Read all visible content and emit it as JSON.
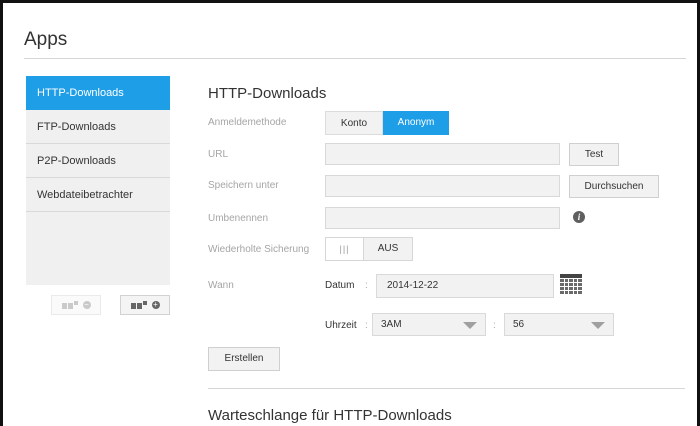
{
  "page": {
    "title": "Apps"
  },
  "sidebar": {
    "items": [
      {
        "label": "HTTP-Downloads",
        "active": true
      },
      {
        "label": "FTP-Downloads",
        "active": false
      },
      {
        "label": "P2P-Downloads",
        "active": false
      },
      {
        "label": "Webdateibetrachter",
        "active": false
      }
    ],
    "buttons": [
      {
        "name": "remove-app",
        "icon": "minus-circle-icon",
        "enabled": false
      },
      {
        "name": "add-app",
        "icon": "plus-circle-icon",
        "enabled": true
      }
    ]
  },
  "main": {
    "section_title": "HTTP-Downloads",
    "login_method": {
      "label": "Anmeldemethode",
      "options": [
        "Konto",
        "Anonym"
      ],
      "selected": "Anonym"
    },
    "url": {
      "label": "URL",
      "value": "",
      "button": "Test"
    },
    "save_to": {
      "label": "Speichern unter",
      "value": "",
      "button": "Durchsuchen"
    },
    "rename": {
      "label": "Umbenennen",
      "value": "",
      "info_icon": "info-icon"
    },
    "repeat_backup": {
      "label": "Wiederholte Sicherung",
      "grip": "|||",
      "state": "AUS"
    },
    "when": {
      "label": "Wann",
      "date_label": "Datum",
      "date_value": "2014-12-22",
      "time_label": "Uhrzeit",
      "separator": ":",
      "hour": "3AM",
      "minute": "56"
    },
    "create_button": "Erstellen",
    "queue_title": "Warteschlange für HTTP-Downloads"
  },
  "colors": {
    "accent": "#1f9ee8",
    "field_bg": "#f2f2f2",
    "label_gray": "#a5a5a5"
  }
}
